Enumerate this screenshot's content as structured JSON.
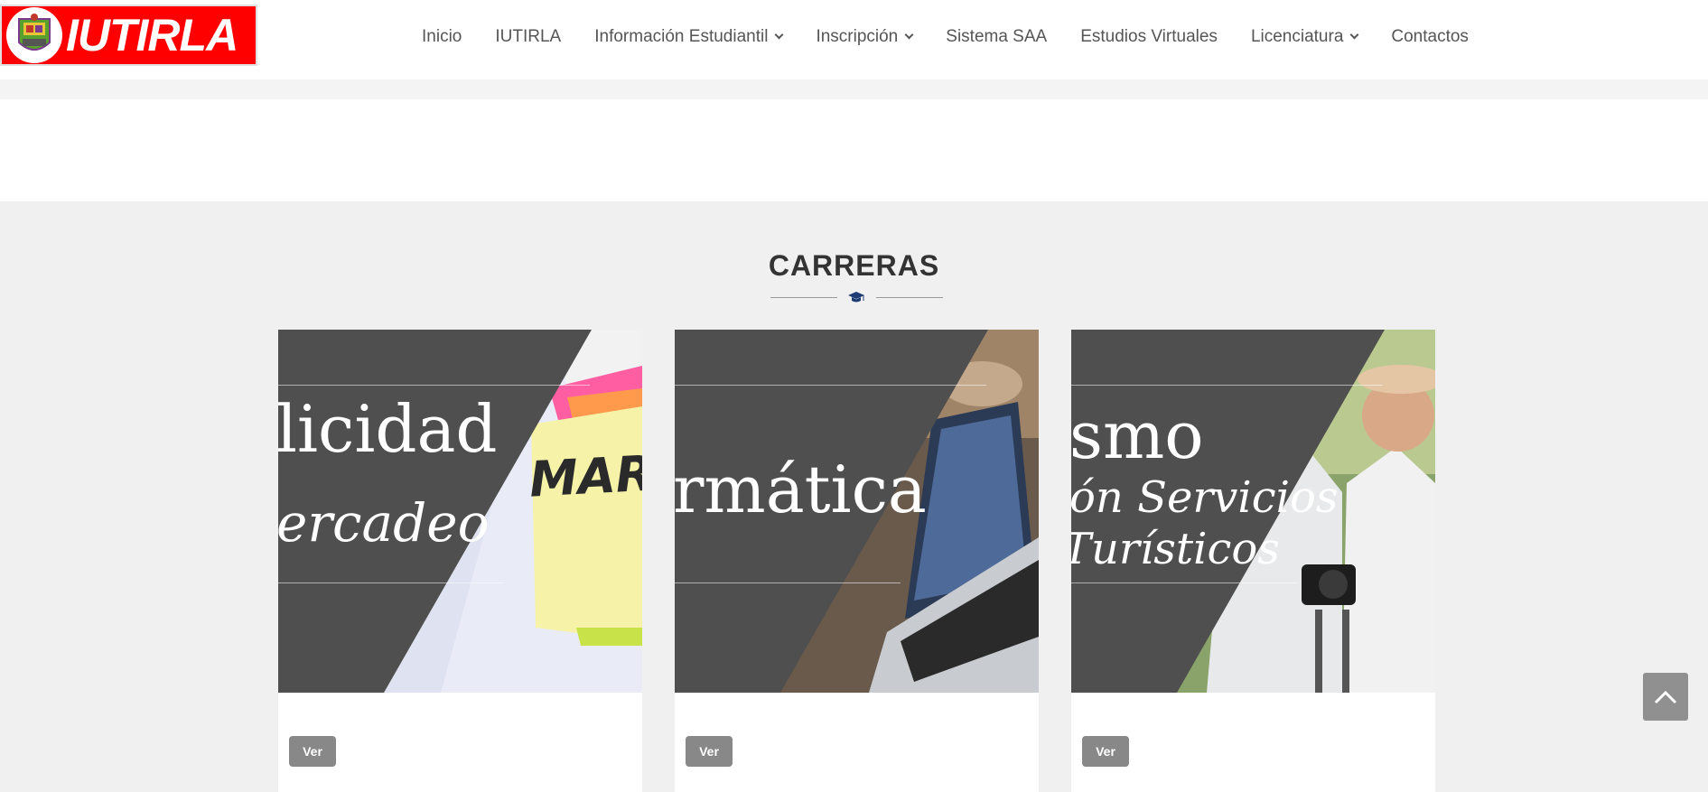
{
  "brand": {
    "name": "IUTIRLA"
  },
  "nav": {
    "items": [
      {
        "label": "Inicio",
        "has_dropdown": false
      },
      {
        "label": "IUTIRLA",
        "has_dropdown": false
      },
      {
        "label": "Información Estudiantil",
        "has_dropdown": true
      },
      {
        "label": "Inscripción",
        "has_dropdown": true
      },
      {
        "label": "Sistema SAA",
        "has_dropdown": false
      },
      {
        "label": "Estudios Virtuales",
        "has_dropdown": false
      },
      {
        "label": "Licenciatura",
        "has_dropdown": true
      },
      {
        "label": "Contactos",
        "has_dropdown": false
      }
    ]
  },
  "section": {
    "title": "CARRERAS",
    "icon": "graduation-cap-icon"
  },
  "cards": [
    {
      "line1": "licidad",
      "line2": "ercadeo",
      "sticky_text": "MARK",
      "button": "Ver"
    },
    {
      "line1": "rmática",
      "button": "Ver"
    },
    {
      "line1": "smo",
      "line2": "ón Servicios",
      "line3": "Turísticos",
      "button": "Ver"
    }
  ],
  "colors": {
    "brand_red": "#ff0000",
    "card_dark": "#4f4f4f",
    "button_gray": "#888888",
    "cap_blue": "#1f3b73"
  }
}
